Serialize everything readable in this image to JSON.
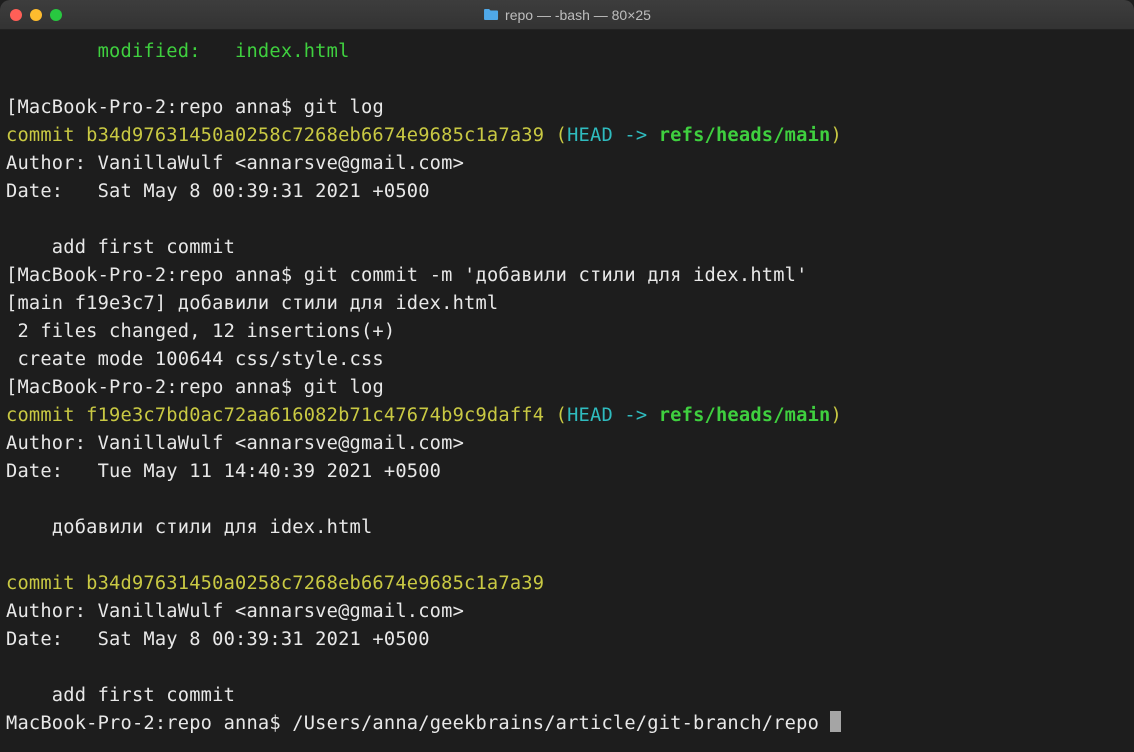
{
  "window": {
    "title": "repo — -bash — 80×25"
  },
  "colors": {
    "close": "#ff5f57",
    "minimize": "#febc2e",
    "maximize": "#28c840",
    "bg": "#1d1d1d",
    "green": "#3fd03f",
    "yellow": "#c9c943",
    "cyan": "#2fbcbf",
    "white": "#e8e8e8"
  },
  "lines": {
    "modified": "        modified:   index.html",
    "blank": "",
    "prompt1_open": "[",
    "prompt1": "MacBook-Pro-2:repo anna$ ",
    "cmd_gitlog": "git log",
    "commit1_hash": "commit b34d97631450a0258c7268eb6674e9685c1a7a39",
    "paren_open": " (",
    "head_arrow": "HEAD -> ",
    "ref_main": "refs/heads/main",
    "paren_close": ")",
    "author1": "Author: VanillaWulf <annarsve@gmail.com>",
    "date1": "Date:   Sat May 8 00:39:31 2021 +0500",
    "msg1": "    add first commit",
    "cmd_commit": "git commit -m 'добавили стили для idex.html'",
    "commit_out1": "[main f19e3c7] добавили стили для idex.html",
    "commit_out2": " 2 files changed, 12 insertions(+)",
    "commit_out3": " create mode 100644 css/style.css",
    "commit2_hash": "commit f19e3c7bd0ac72aa616082b71c47674b9c9daff4",
    "author2": "Author: VanillaWulf <annarsve@gmail.com>",
    "date2": "Date:   Tue May 11 14:40:39 2021 +0500",
    "msg2": "    добавили стили для idex.html",
    "commit3_hash": "commit b34d97631450a0258c7268eb6674e9685c1a7a39",
    "author3": "Author: VanillaWulf <annarsve@gmail.com>",
    "date3": "Date:   Sat May 8 00:39:31 2021 +0500",
    "msg3": "    add first commit",
    "prompt_last": "MacBook-Pro-2:repo anna$ ",
    "cwd": "/Users/anna/geekbrains/article/git-branch/repo "
  }
}
